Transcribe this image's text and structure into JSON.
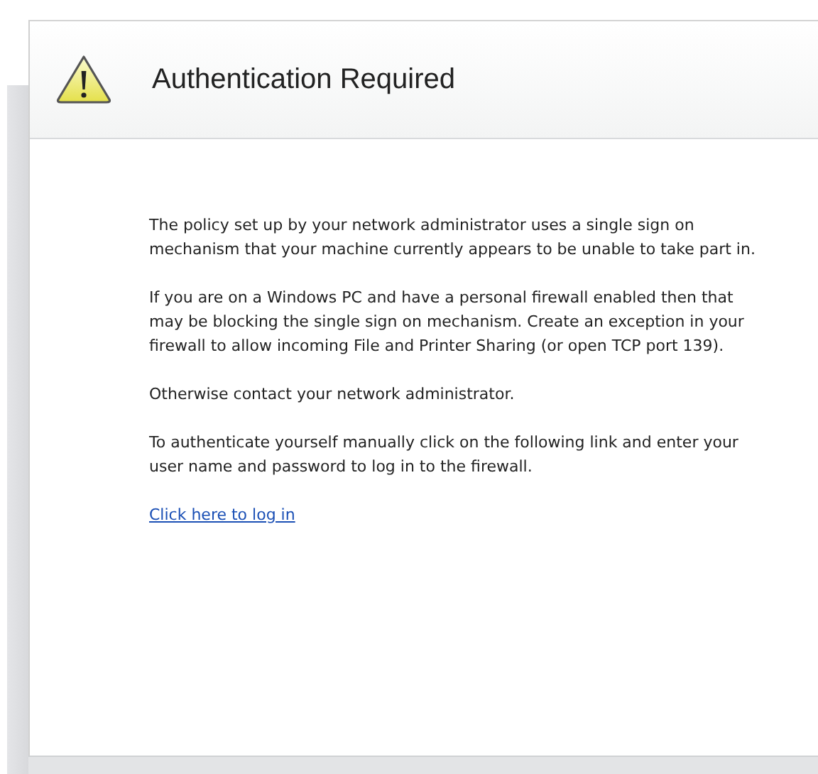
{
  "header": {
    "title": "Authentication Required"
  },
  "paragraphs": [
    "The policy set up by your network administrator uses a single sign on mechanism that your machine currently appears to be unable to take part in.",
    "If you are on a Windows PC and have a personal firewall enabled then that may be blocking the single sign on mechanism. Create an exception in your firewall to allow incoming File and Printer Sharing (or open TCP port 139).",
    "Otherwise contact your network administrator.",
    "To authenticate yourself manually click on the following link and enter your user name and password to log in to the firewall."
  ],
  "link": "Click here to log in"
}
